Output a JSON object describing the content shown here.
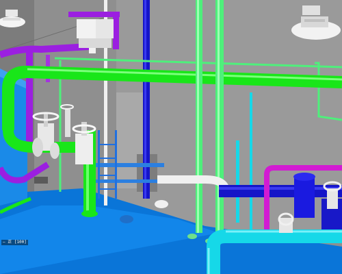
{
  "viewport": {
    "status_label": "— 正 [100]"
  },
  "colors": {
    "wall": "#8f8f8f",
    "floor": "#0a75d8",
    "pipe_green": "#19e619",
    "pipe_light_green": "#4ef07b",
    "pipe_pale_green": "#89e789",
    "pipe_purple": "#9b1fe0",
    "pipe_magenta": "#d21bd2",
    "pipe_blue": "#1515c8",
    "pipe_cyan": "#16d8e8",
    "pipe_white": "#f0f0f0",
    "pipe_teal": "#16c4c4"
  },
  "icons": {
    "light_fixture": "ceiling-lamp-icon",
    "valve_handwheel": "handwheel-valve-icon"
  }
}
